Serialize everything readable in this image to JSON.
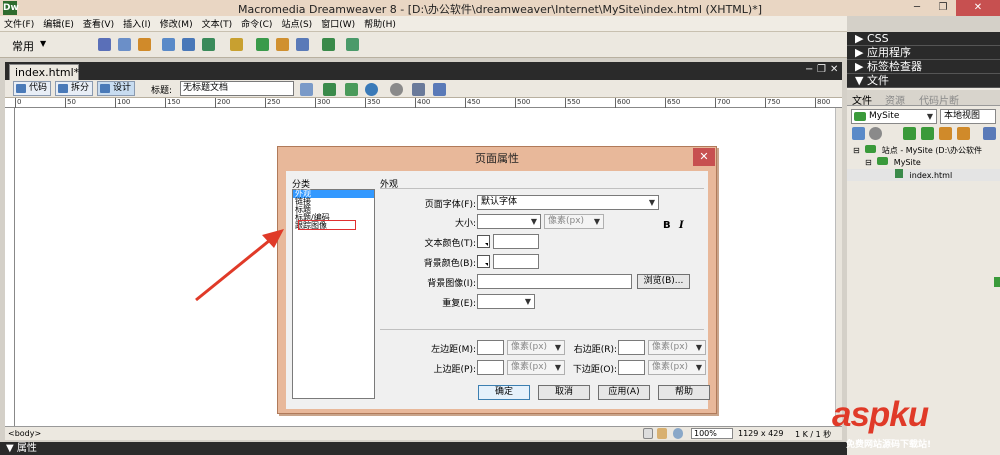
{
  "window": {
    "title": "Macromedia Dreamweaver 8 - [D:\\办公软件\\dreamweaver\\Internet\\MySite\\index.html (XHTML)*]",
    "app_icon": "Dw",
    "controls": [
      "─",
      "❐",
      "✕"
    ]
  },
  "menu": [
    "文件(F)",
    "编辑(E)",
    "查看(V)",
    "插入(I)",
    "修改(M)",
    "文本(T)",
    "命令(C)",
    "站点(S)",
    "窗口(W)",
    "帮助(H)"
  ],
  "insert_bar": {
    "category": "常用"
  },
  "document": {
    "tab_label": "index.html*",
    "views": {
      "code": "代码",
      "split": "拆分",
      "design": "设计"
    },
    "title_label": "标题:",
    "title_value": "无标题文档",
    "ruler_labels": [
      "0",
      "50",
      "100",
      "150",
      "200",
      "250",
      "300",
      "350",
      "400",
      "450",
      "500",
      "550",
      "600",
      "650",
      "700",
      "750",
      "800"
    ]
  },
  "status": {
    "tag_selector": "<body>",
    "zoom": "100%",
    "window_size": "1129 x 429",
    "file_size": "1 K / 1 秒"
  },
  "properties_label": "▼ 属性",
  "right_panel": {
    "groups": [
      "▶ CSS",
      "▶ 应用程序",
      "▶ 标签检查器",
      "▼ 文件"
    ],
    "tabs": [
      "文件",
      "资源",
      "代码片断"
    ],
    "site": "MySite",
    "view": "本地视图",
    "tree": [
      {
        "indent": 0,
        "toggle": "⊟",
        "label": "站点 - MySite (D:\\办公软件"
      },
      {
        "indent": 1,
        "toggle": "⊟",
        "label": "MySite"
      },
      {
        "indent": 2,
        "toggle": "",
        "label": "index.html"
      }
    ]
  },
  "dialog": {
    "title": "页面属性",
    "close": "✕",
    "category_label": "分类",
    "categories": [
      "外观",
      "链接",
      "标题",
      "标题/编码",
      "跟踪图像"
    ],
    "selected_category": 0,
    "section_title": "外观",
    "page_font_label": "页面字体(F):",
    "page_font_value": "默认字体",
    "bold": "B",
    "italic": "I",
    "size_label": "大小:",
    "size_unit": "像素(px)",
    "text_color_label": "文本颜色(T):",
    "bg_color_label": "背景颜色(B):",
    "bg_image_label": "背景图像(I):",
    "browse_button": "浏览(B)...",
    "repeat_label": "重复(E):",
    "left_margin_label": "左边距(M):",
    "right_margin_label": "右边距(R):",
    "top_margin_label": "上边距(P):",
    "bottom_margin_label": "下边距(O):",
    "margin_unit": "像素(px)",
    "ok": "确定",
    "cancel": "取消",
    "apply": "应用(A)",
    "help": "帮助"
  },
  "watermark": {
    "main": "aspku",
    "sub": "免费网站源码下载站!"
  },
  "colors": {
    "dialog_frame": "#e8b89a",
    "selection": "#3399ff",
    "annotation_red": "#e03a28"
  }
}
